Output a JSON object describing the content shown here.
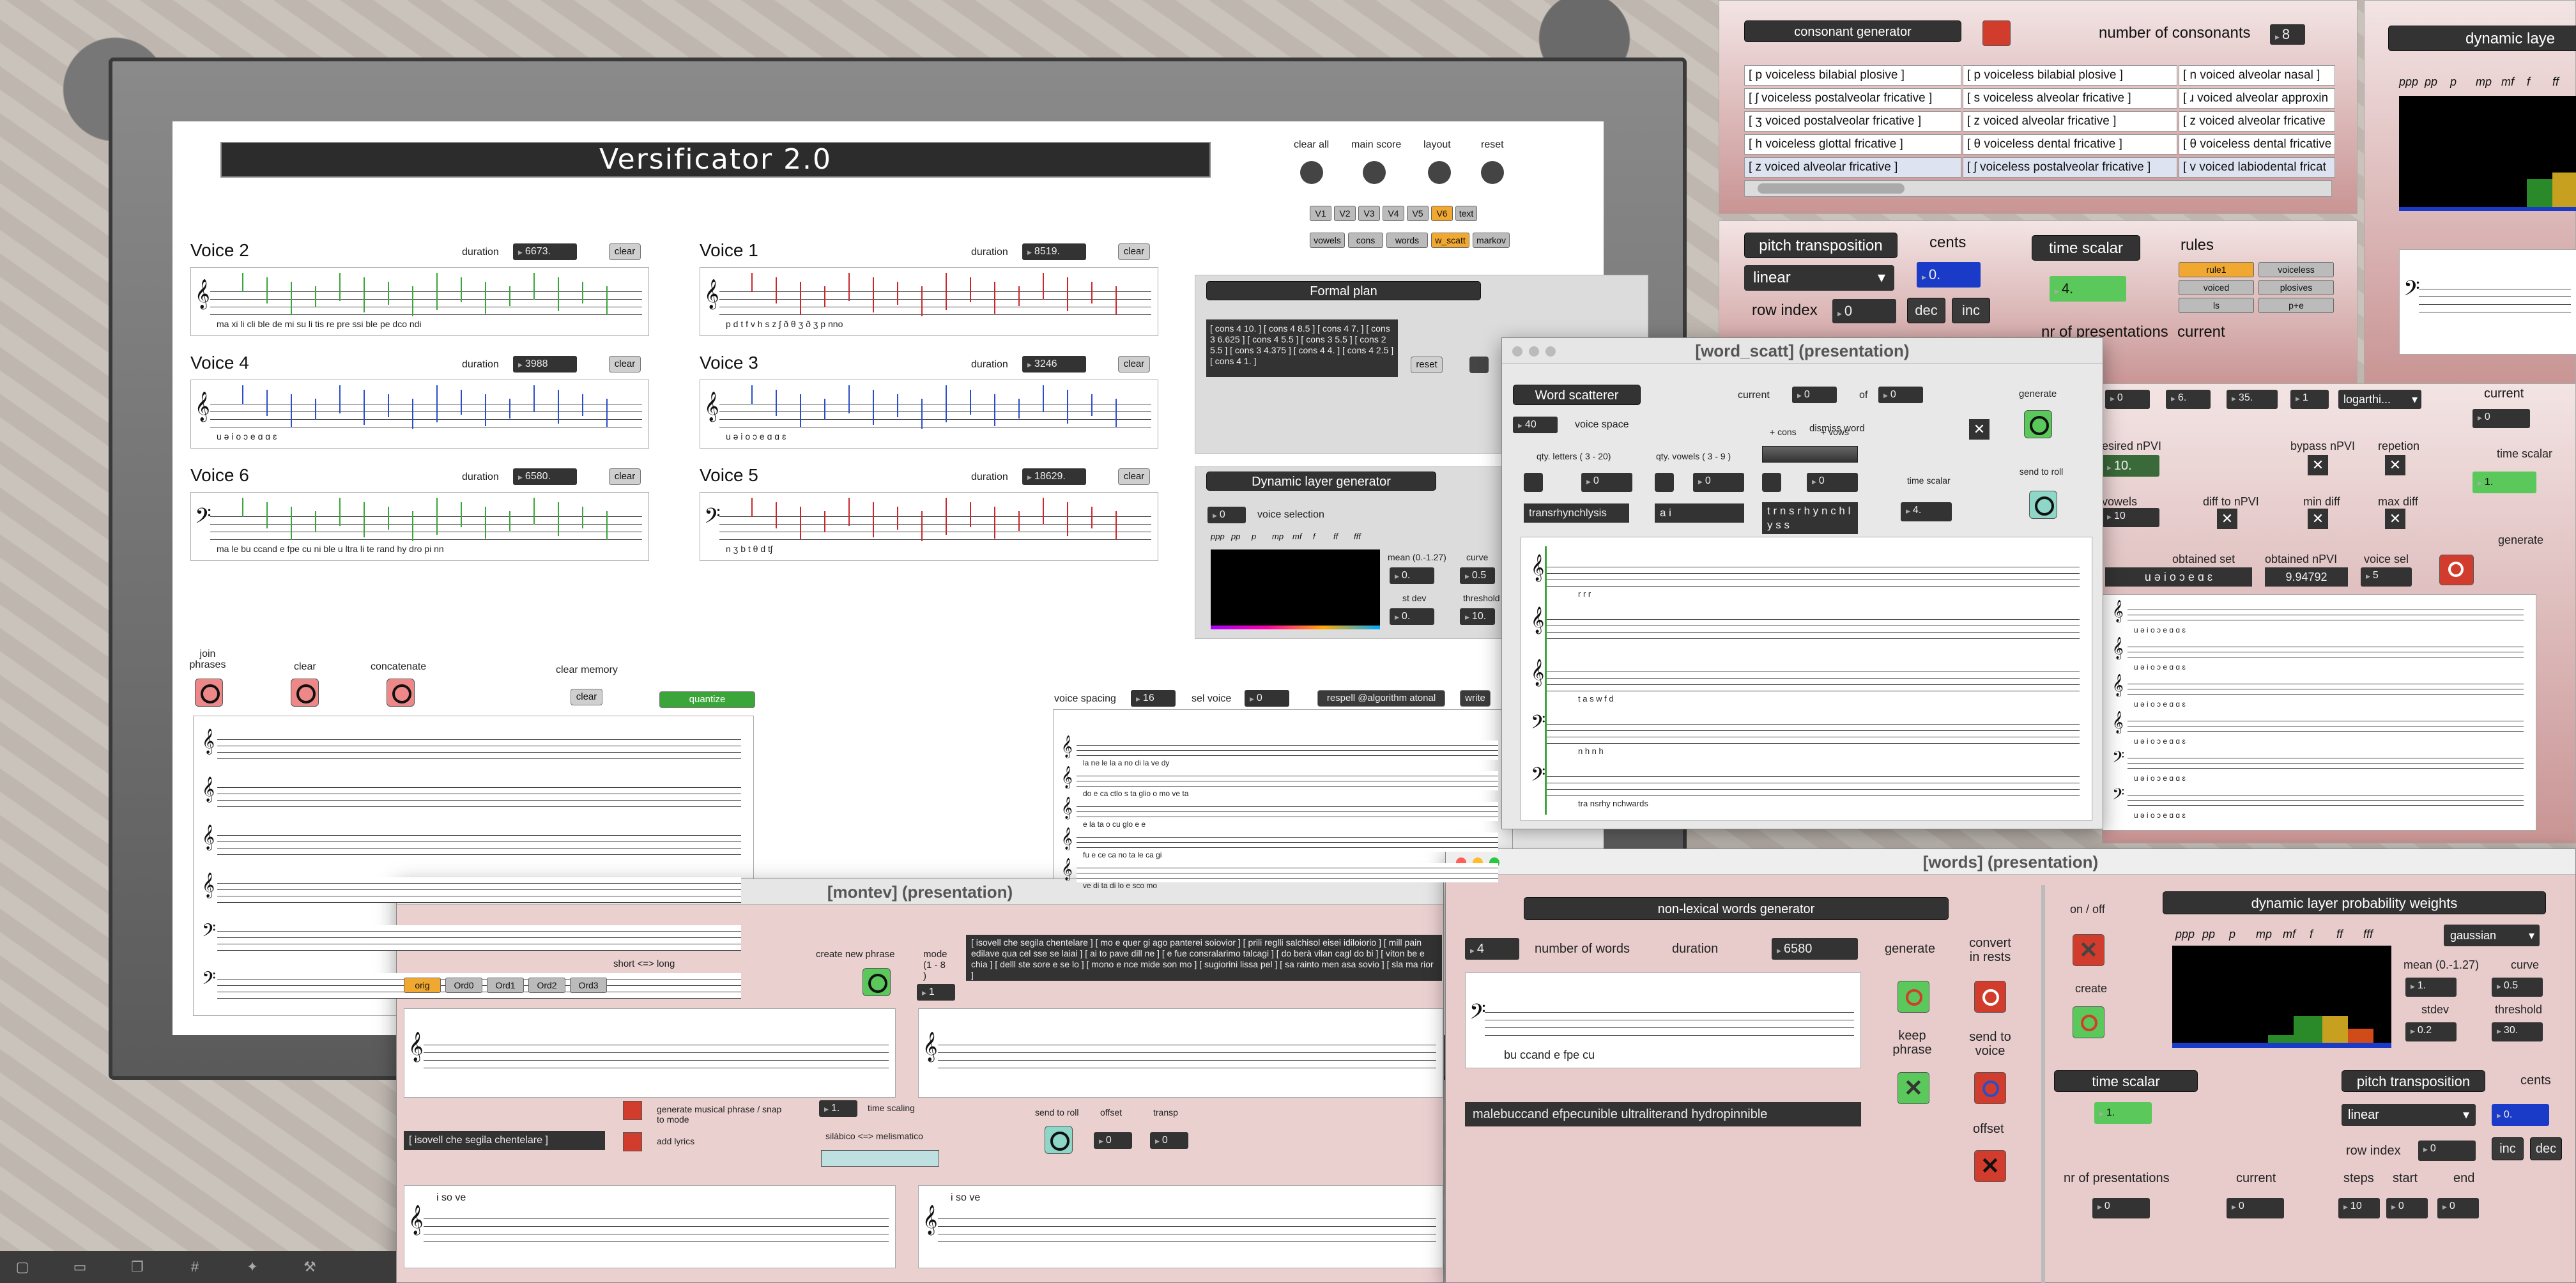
{
  "main": {
    "title": "Versificator 2.0",
    "top_buttons": [
      "clear all",
      "main score",
      "layout",
      "reset"
    ],
    "voice_tabs": [
      "V1",
      "V2",
      "V3",
      "V4",
      "V5",
      "V6",
      "text"
    ],
    "mode_tabs": [
      "vowels",
      "cons",
      "words",
      "w_scatt",
      "markov"
    ],
    "voices": [
      {
        "name": "Voice 2",
        "duration": "6673.",
        "lyrics": "ma  xi  li  cli  ble       de   mi   su   li   tis      re  pre  ssi  ble        pe  dco  ndi"
      },
      {
        "name": "Voice 1",
        "duration": "8519.",
        "lyrics": "p   d   t   f   v  h  s  z  ʃ   ð         θ    ʒ   ð             ʒ          p  nno"
      },
      {
        "name": "Voice 4",
        "duration": "3988",
        "lyrics": "u   ə   i   o   ɔ   e   ɑ  ɑ  ɛ"
      },
      {
        "name": "Voice 3",
        "duration": "3246",
        "lyrics": "u   ə   i   o   ɔ   e   ɑ  ɑ  ɛ"
      },
      {
        "name": "Voice 6",
        "duration": "6580.",
        "lyrics": "ma  le  bu ccand   e  fpe  cu  ni  ble       u   ltra  li  te  rand       hy  dro  pi  nn"
      },
      {
        "name": "Voice 5",
        "duration": "18629.",
        "lyrics": "n          ʒ          b          t          θ          d       tʃ"
      }
    ],
    "clear_label": "clear",
    "duration_label": "duration",
    "formal_plan": {
      "title": "Formal plan",
      "text": "[ cons 4 10. ] [ cons 4 8.5 ] [ cons 4 7. ] [ cons 3 6.625 ] [ cons 4 5.5 ] [ cons 3 5.5 ] [ cons 2 5.5 ] [ cons 3 4.375 ] [ cons 4 4. ] [ cons 4 2.5 ] [ cons 4 1. ]",
      "reset": "reset"
    },
    "dynamic_layer": {
      "title": "Dynamic layer generator",
      "voice_sel": "0",
      "voice_sel_label": "voice selection",
      "dyn": [
        "ppp",
        "pp",
        "p",
        "mp",
        "mf",
        "f",
        "ff",
        "fff"
      ],
      "mean_label": "mean (0.-1.27)",
      "mean": "0.",
      "curve_label": "curve",
      "curve": "0.5",
      "stdev_label": "st dev",
      "stdev": "0.",
      "threshold_label": "threshold",
      "threshold": "10."
    },
    "join_phrases": "join phrases",
    "clear": "clear",
    "concatenate": "concatenate",
    "clear_memory": "clear memory",
    "quantize": "quantize",
    "voice_spacing_label": "voice spacing",
    "voice_spacing": "16",
    "sel_voice_label": "sel voice",
    "sel_voice": "0",
    "respell": "respell @algorithm atonal",
    "write": "write",
    "score_lyrics": [
      "la  ne  le  la  a  no  di  la  ve  dy",
      "do  e  ca  ctlo  s  ta  glio  o  mo  ve  ta",
      "e  la  ta  o  cu  glo  e  e",
      "fu  e  ce  ca  no  ta  le  ca  gi",
      "ve  di  ta  di  lo  e  sco  mo"
    ]
  },
  "consonant": {
    "title": "consonant generator",
    "num_label": "number of consonants",
    "num": "8",
    "cells": [
      [
        "[ p voiceless bilabial plosive ]",
        "[ p voiceless bilabial plosive ]",
        "[ n voiced alveolar nasal ]"
      ],
      [
        "[ ʃ voiceless postalveolar fricative ]",
        "[ s voiceless alveolar fricative ]",
        "[ ɹ voiced alveolar approxin"
      ],
      [
        "[ ʒ voiced postalveolar fricative ]",
        "[ z voiced alveolar fricative ]",
        "[ z voiced alveolar fricative"
      ],
      [
        "[ h voiceless glottal fricative ]",
        "[ θ voiceless dental fricative ]",
        "[ θ voiceless dental fricative"
      ],
      [
        "[ z voiced alveolar fricative ]",
        "[ ʃ voiceless postalveolar fricative ]",
        "[ v voiced labiodental fricat"
      ]
    ],
    "pitch_transposition": "pitch transposition",
    "cents_label": "cents",
    "cents": "0.",
    "linear": "linear",
    "row_index_label": "row index",
    "row_index": "0",
    "dec": "dec",
    "inc": "inc",
    "time_scalar": "time scalar",
    "time_scalar_val": "4.",
    "rules_label": "rules",
    "rules": [
      "rule1",
      "voiceless",
      "voiced",
      "plosives",
      "ls",
      "p+e"
    ],
    "nr_presentations": "nr of presentations",
    "current": "current"
  },
  "dyn_right": {
    "title": "dynamic laye",
    "dyn": [
      "ppp",
      "pp",
      "p",
      "mp",
      "mf",
      "f",
      "ff"
    ]
  },
  "word_scatt": {
    "window_title": "[word_scatt] (presentation)",
    "title": "Word scatterer",
    "current_label": "current",
    "current": "0",
    "of_label": "of",
    "of": "0",
    "generate": "generate",
    "dismiss": "dismiss word",
    "voice_space": "40",
    "voice_space_label": "voice space",
    "qty_letters": "qty. letters ( 3 - 20)",
    "qty_vowels": "qty. vowels ( 3 - 9 )",
    "cons": "+ cons",
    "vows": "+ vows",
    "time_scalar": "time scalar",
    "time_scalar_val": "4.",
    "send_to_roll": "send to roll",
    "v0": "0",
    "v1": "0",
    "v2": "0",
    "word1": "transrhynchlysis",
    "word2": "a i",
    "word3": "t r n s r h y n c h l y s s",
    "staff_lyrics": [
      "r     r          r",
      "",
      "t       a  s               w  f  d",
      "n           h        n        h",
      "tra    nsrhy    nchwards"
    ]
  },
  "right_mid": {
    "current_label": "current",
    "current": "0",
    "vals": [
      "0",
      "6.",
      "35.",
      "1"
    ],
    "log": "logarthi...",
    "desired_npvi": "esired nPVI",
    "npvi": "10.",
    "bypass": "bypass nPVI",
    "repetition": "repetion",
    "vowels_label": "vowels",
    "vowels": "10",
    "diff_npvi": "diff to nPVI",
    "min_diff": "min diff",
    "max_diff": "max diff",
    "time_scalar": "time scalar",
    "time_scalar_val": "1.",
    "obtained_set_label": "obtained set",
    "obtained_set": "u ə i o ɔ e ɑ ɛ",
    "obtained_npvi_label": "obtained nPVI",
    "obtained_npvi": "9.94792",
    "voice_sel_label": "voice sel",
    "voice_sel": "5",
    "generate": "generate",
    "staff_lyrics": "u   ə   i   o   ɔ   e   ɑ   ɑ   ɛ"
  },
  "montev": {
    "window_title": "[montev] (presentation)",
    "tabs": [
      "orig",
      "Ord0",
      "Ord1",
      "Ord2",
      "Ord3"
    ],
    "short_long": "short <=> long",
    "create_new": "create new phrase",
    "mode_label": "mode (1 - 8 )",
    "mode": "1",
    "text": "[ isovell che segila chentelare ] [ mo e quer gi ago panterei soiovior ] [ prili reglli salchisol eisei idiloiorio ] [ mill pain edilave qua cel sse se laiai ] [ ai to pave dill ne ] [ e fue consralarimo talcagi ] [ do berà vilan cagl do bi ] [ viton be e chia ] [ delll ste sore e se lo ] [ mono e nce mide son mo ] [ sugiorini lissa pel ] [ sa rainto men asa sovio ] [ sla ma rior ]",
    "gen_musical": "generate musical phrase / snap to mode",
    "add_lyrics": "add lyrics",
    "phrase": "[ isovell che segila chentelare ]",
    "time_scaling_label": "time scaling",
    "time_scaling": "1.",
    "silabico": "silàbico <=> melismatico",
    "send_to_roll": "send to roll",
    "offset": "offset",
    "offset_val": "0",
    "transp": "transp",
    "transp_val": "0",
    "lyrics": [
      "i            so            ve",
      "i            so            ve"
    ]
  },
  "words": {
    "window_title": "[words] (presentation)",
    "title": "non-lexical words generator",
    "num": "4",
    "num_label": "number of words",
    "duration_label": "duration",
    "duration": "6580",
    "generate": "generate",
    "convert": "convert in rests",
    "keep": "keep phrase",
    "send_voice": "send to voice",
    "offset": "offset",
    "staff_lyrics": "bu      ccand                 e            fpe          cu",
    "output": "malebuccand efpecunible ultraliterand hydropinnible",
    "on_off": "on / off",
    "create": "create",
    "dyn_title": "dynamic layer probability weights",
    "dist": "gaussian",
    "dyn": [
      "ppp",
      "pp",
      "p",
      "mp",
      "mf",
      "f",
      "ff",
      "fff"
    ],
    "mean_label": "mean (0.-1.27)",
    "mean": "1.",
    "curve_label": "curve",
    "curve": "0.5",
    "stdev_label": "stdev",
    "stdev": "0.2",
    "threshold_label": "threshold",
    "threshold": "30.",
    "time_scalar": "time scalar",
    "time_scalar_val": "1.",
    "pitch_transposition": "pitch transposition",
    "cents_label": "cents",
    "cents": "0.",
    "linear": "linear",
    "row_index_label": "row index",
    "row_index": "0",
    "inc": "inc",
    "dec": "dec",
    "nr_pres": "nr of presentations",
    "nr_val": "0",
    "current": "current",
    "current_val": "0",
    "steps": "steps",
    "steps_val": "10",
    "start": "start",
    "start_val": "0",
    "end": "end",
    "end_val": "0"
  },
  "colors": {
    "accent_orange": "#f0a830",
    "green": "#3aa63a",
    "red": "#d23c2c",
    "blue": "#2a4ec8",
    "hist": [
      "#2a8a2a",
      "#c8a020",
      "#d04a1a",
      "#1a3ac8"
    ]
  }
}
